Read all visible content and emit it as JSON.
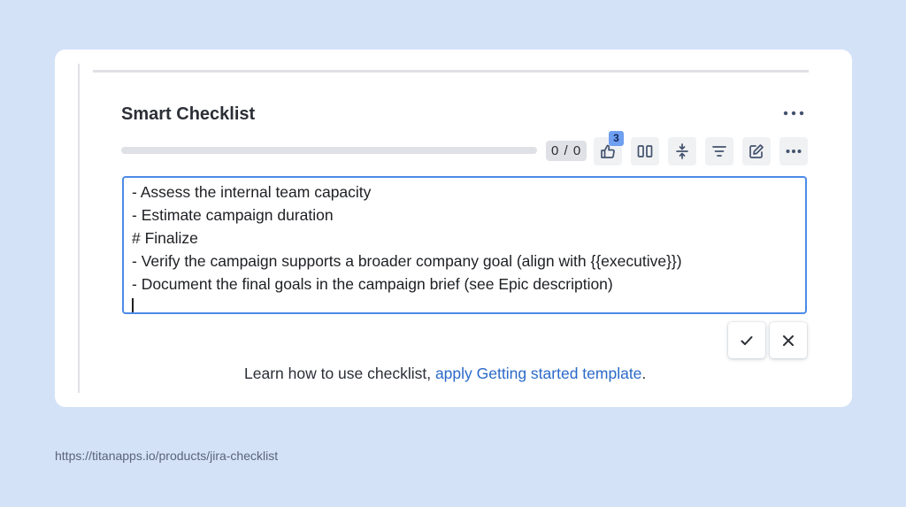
{
  "checklist": {
    "title": "Smart Checklist",
    "counter": "0 / 0",
    "progress_fraction": 0,
    "toolbar": {
      "badge_count": "3",
      "icons": [
        "thumbs-up-icon",
        "columns-icon",
        "collapse-icon",
        "filter-icon",
        "edit-icon",
        "more-icon"
      ]
    },
    "header_more_icon": "more-icon",
    "editor_lines": [
      "- Assess the internal team capacity",
      "- Estimate campaign duration",
      "# Finalize",
      "- Verify the campaign supports a broader company goal (align with {{executive}})",
      "- Document the final goals in the campaign brief (see Epic description)"
    ],
    "help_text": "Learn how to use checklist, ",
    "help_link": "apply Getting started template",
    "help_suffix": "."
  },
  "footer": {
    "url": "https://titanapps.io/products/jira-checklist"
  },
  "colors": {
    "background": "#d3e2f7",
    "accent": "#4c8be8",
    "link": "#2a6ac8",
    "badge": "#6f9ff0"
  }
}
